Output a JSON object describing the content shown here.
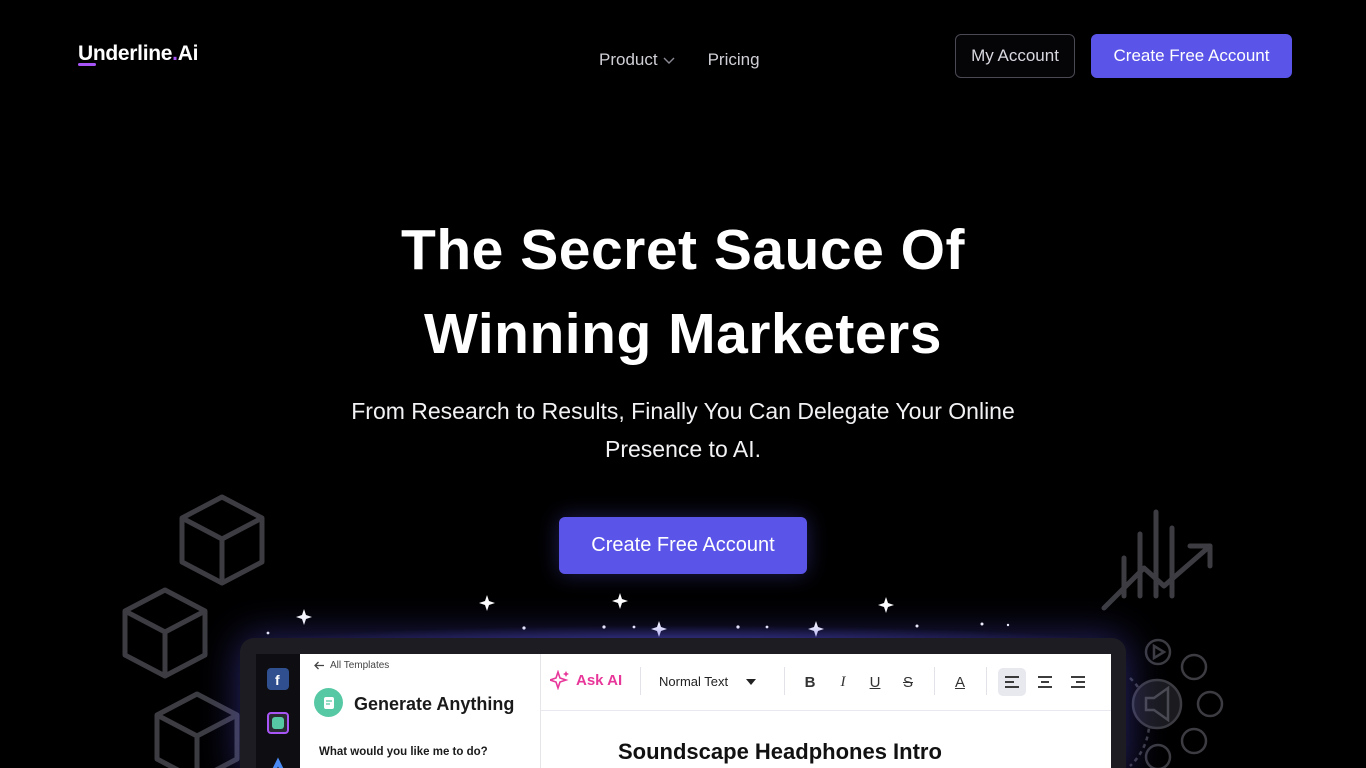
{
  "brand": {
    "name_main": "Underline",
    "name_dot": ".",
    "name_suffix": "Ai",
    "accent": "#a855f7"
  },
  "nav": {
    "links": [
      {
        "label": "Product",
        "has_dropdown": true
      },
      {
        "label": "Pricing",
        "has_dropdown": false
      }
    ],
    "my_account_label": "My Account",
    "create_account_label": "Create Free Account"
  },
  "hero": {
    "title_line1": "The Secret Sauce Of",
    "title_line2": "Winning Marketers",
    "subtitle": "From Research to Results, Finally You Can Delegate Your Online Presence to AI.",
    "cta_label": "Create Free Account"
  },
  "app_preview": {
    "back_label": "All Templates",
    "panel_title": "Generate Anything",
    "panel_question": "What would you like me to do?",
    "toolbar": {
      "ask_ai_label": "Ask AI",
      "text_style": "Normal Text"
    },
    "document_title": "Soundscape Headphones Intro"
  },
  "colors": {
    "primary": "#5a55e8",
    "background": "#000000",
    "ask_ai": "#e8379a"
  }
}
